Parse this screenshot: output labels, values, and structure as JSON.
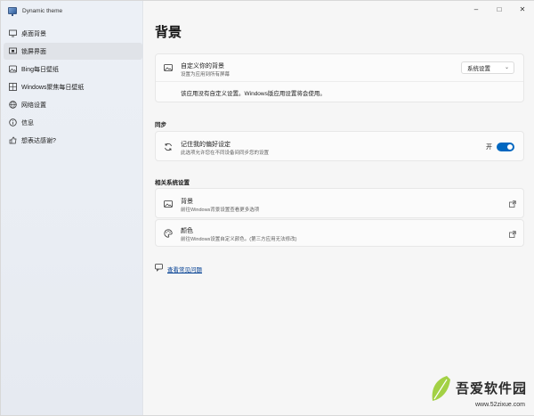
{
  "app": {
    "title": "Dynamic theme"
  },
  "window_controls": {
    "minimize": "–",
    "maximize": "□",
    "close": "✕"
  },
  "sidebar": {
    "items": [
      {
        "label": "桌面背景",
        "icon": "desktop-icon"
      },
      {
        "label": "锁屏界面",
        "icon": "lock-screen-icon"
      },
      {
        "label": "Bing每日壁纸",
        "icon": "image-icon"
      },
      {
        "label": "Windows聚焦每日壁纸",
        "icon": "grid-image-icon"
      },
      {
        "label": "网络设置",
        "icon": "globe-icon"
      },
      {
        "label": "信息",
        "icon": "info-icon"
      },
      {
        "label": "想表达感谢?",
        "icon": "thumb-up-icon"
      }
    ]
  },
  "main": {
    "title": "背景",
    "custom_background": {
      "title": "自定义你的背景",
      "subtitle": "设置为应用到所有屏幕",
      "select_value": "系统设置",
      "notice": "该应用没有自定义设置。Windows版应用设置将会使用。"
    },
    "sync": {
      "section": "同步",
      "title": "记住我的偏好设定",
      "subtitle": "此选项允许您在不同设备间同步您的设置",
      "toggle_label": "开",
      "toggle_on": true
    },
    "related": {
      "section": "相关系统设置",
      "items": [
        {
          "title": "背景",
          "subtitle": "前往Windows背景设置查看更多选项",
          "icon": "image-icon"
        },
        {
          "title": "颜色",
          "subtitle": "前往Windows设置自定义颜色。(第三方应用无法修改)",
          "icon": "palette-icon"
        }
      ]
    },
    "faq_link": "查看常见问题"
  },
  "watermark": {
    "text": "吾爱软件园",
    "url": "www.52zixue.com"
  },
  "colors": {
    "accent": "#0067c0",
    "link": "#003e92"
  }
}
